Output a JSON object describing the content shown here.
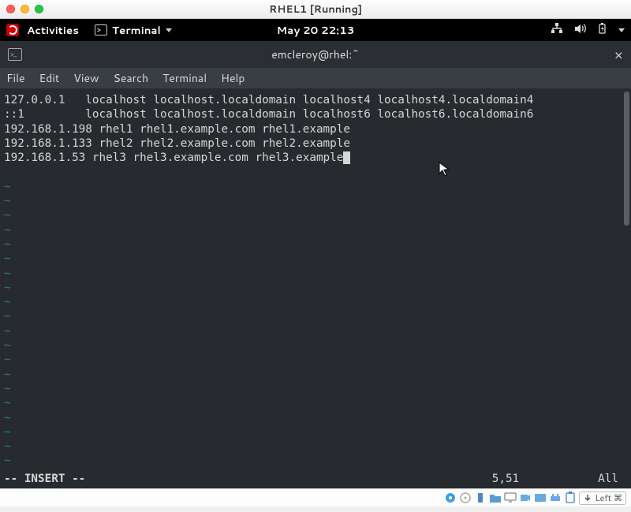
{
  "window": {
    "title": "RHEL1 [Running]"
  },
  "gnome": {
    "activities": "Activities",
    "app_label": "Terminal",
    "clock": "May 20  22:13"
  },
  "terminal": {
    "title": "emcleroy@rhel:~",
    "menus": [
      "File",
      "Edit",
      "View",
      "Search",
      "Terminal",
      "Help"
    ],
    "lines": [
      "127.0.0.1   localhost localhost.localdomain localhost4 localhost4.localdomain4",
      "::1         localhost localhost.localdomain localhost6 localhost6.localdomain6",
      "192.168.1.198 rhel1 rhel1.example.com rhel1.example",
      "192.168.1.133 rhel2 rhel2.example.com rhel2.example",
      "192.168.1.53 rhel3 rhel3.example.com rhel3.example"
    ],
    "mode": "-- INSERT --",
    "position": "5,51",
    "scroll": "All"
  },
  "vbox": {
    "capture_label": "Left ⌘"
  }
}
